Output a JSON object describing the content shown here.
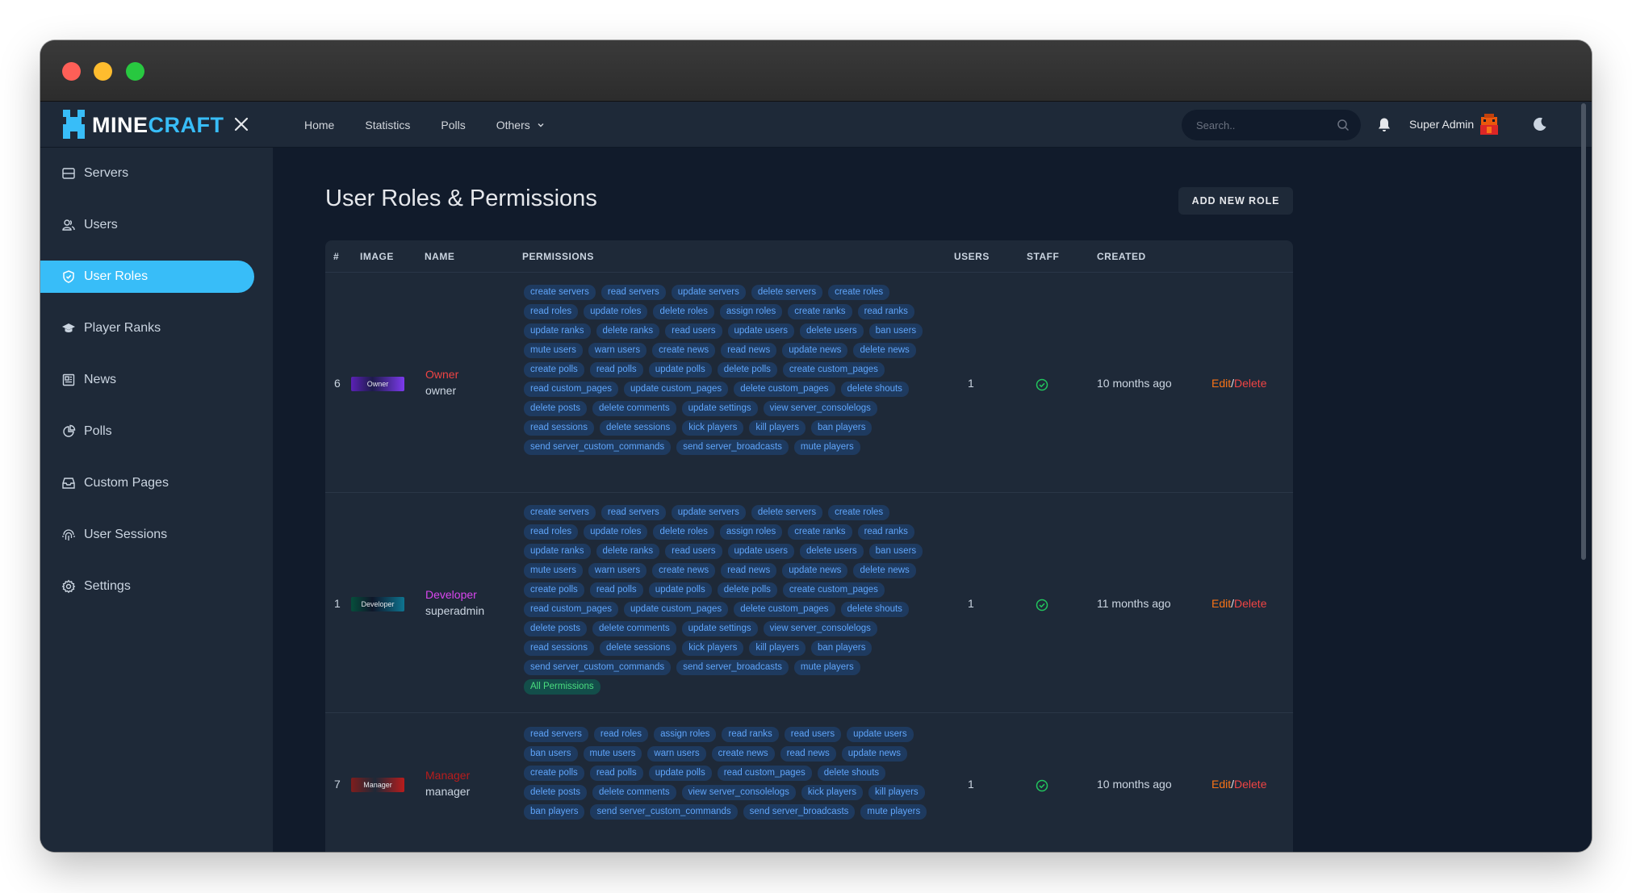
{
  "brand": {
    "name_part1": "MINE",
    "name_part2": "CRAFT"
  },
  "sidebar": {
    "items": [
      {
        "label": "Servers",
        "icon": "server-icon",
        "active": false
      },
      {
        "label": "Users",
        "icon": "users-icon",
        "active": false
      },
      {
        "label": "User Roles",
        "icon": "shield-icon",
        "active": true
      },
      {
        "label": "Player Ranks",
        "icon": "graduation-cap-icon",
        "active": false
      },
      {
        "label": "News",
        "icon": "newspaper-icon",
        "active": false
      },
      {
        "label": "Polls",
        "icon": "pie-chart-icon",
        "active": false
      },
      {
        "label": "Custom Pages",
        "icon": "inbox-icon",
        "active": false
      },
      {
        "label": "User Sessions",
        "icon": "fingerprint-icon",
        "active": false
      },
      {
        "label": "Settings",
        "icon": "gear-icon",
        "active": false
      }
    ]
  },
  "topnav": {
    "home": "Home",
    "statistics": "Statistics",
    "polls": "Polls",
    "others": "Others"
  },
  "search": {
    "placeholder": "Search.."
  },
  "user": {
    "name": "Super Admin"
  },
  "page": {
    "title": "User Roles & Permissions",
    "add_button": "ADD NEW ROLE"
  },
  "table": {
    "headers": {
      "id": "#",
      "image": "IMAGE",
      "name": "NAME",
      "permissions": "PERMISSIONS",
      "users": "USERS",
      "staff": "STAFF",
      "created": "CREATED"
    },
    "rows": [
      {
        "id": "6",
        "image_label": "Owner",
        "name": "Owner",
        "name_color": "#ef4444",
        "slug": "owner",
        "permissions": [
          "create servers",
          "read servers",
          "update servers",
          "delete servers",
          "create roles",
          "read roles",
          "update roles",
          "delete roles",
          "assign roles",
          "create ranks",
          "read ranks",
          "update ranks",
          "delete ranks",
          "read users",
          "update users",
          "delete users",
          "ban users",
          "mute users",
          "warn users",
          "create news",
          "read news",
          "update news",
          "delete news",
          "create polls",
          "read polls",
          "update polls",
          "delete polls",
          "create custom_pages",
          "read custom_pages",
          "update custom_pages",
          "delete custom_pages",
          "delete shouts",
          "delete posts",
          "delete comments",
          "update settings",
          "view server_consolelogs",
          "read sessions",
          "delete sessions",
          "kick players",
          "kill players",
          "ban players",
          "send server_custom_commands",
          "send server_broadcasts",
          "mute players"
        ],
        "users": "1",
        "created": "10 months ago",
        "edit": "Edit",
        "sep": "/",
        "delete": "Delete"
      },
      {
        "id": "1",
        "image_label": "Developer",
        "name": "Developer",
        "name_color": "#d946ef",
        "slug": "superadmin",
        "permissions": [
          "create servers",
          "read servers",
          "update servers",
          "delete servers",
          "create roles",
          "read roles",
          "update roles",
          "delete roles",
          "assign roles",
          "create ranks",
          "read ranks",
          "update ranks",
          "delete ranks",
          "read users",
          "update users",
          "delete users",
          "ban users",
          "mute users",
          "warn users",
          "create news",
          "read news",
          "update news",
          "delete news",
          "create polls",
          "read polls",
          "update polls",
          "delete polls",
          "create custom_pages",
          "read custom_pages",
          "update custom_pages",
          "delete custom_pages",
          "delete shouts",
          "delete posts",
          "delete comments",
          "update settings",
          "view server_consolelogs",
          "read sessions",
          "delete sessions",
          "kick players",
          "kill players",
          "ban players",
          "send server_custom_commands",
          "send server_broadcasts",
          "mute players"
        ],
        "special_permission": "All Permissions",
        "users": "1",
        "created": "11 months ago",
        "edit": "Edit",
        "sep": "/",
        "delete": "Delete"
      },
      {
        "id": "7",
        "image_label": "Manager",
        "name": "Manager",
        "name_color": "#b91c1c",
        "slug": "manager",
        "permissions": [
          "read servers",
          "read roles",
          "assign roles",
          "read ranks",
          "read users",
          "update users",
          "ban users",
          "mute users",
          "warn users",
          "create news",
          "read news",
          "update news",
          "create polls",
          "read polls",
          "update polls",
          "read custom_pages",
          "delete shouts",
          "delete posts",
          "delete comments",
          "view server_consolelogs",
          "kick players",
          "kill players",
          "ban players",
          "send server_custom_commands",
          "send server_broadcasts",
          "mute players"
        ],
        "users": "1",
        "created": "10 months ago",
        "edit": "Edit",
        "sep": "/",
        "delete": "Delete"
      }
    ]
  },
  "colors": {
    "accent": "#38bdf8",
    "sidebar": "#1e2938",
    "background": "#111b2b",
    "tag_bg": "#1e3a5f",
    "tag_text": "#60a5fa",
    "success": "#22c55e"
  }
}
